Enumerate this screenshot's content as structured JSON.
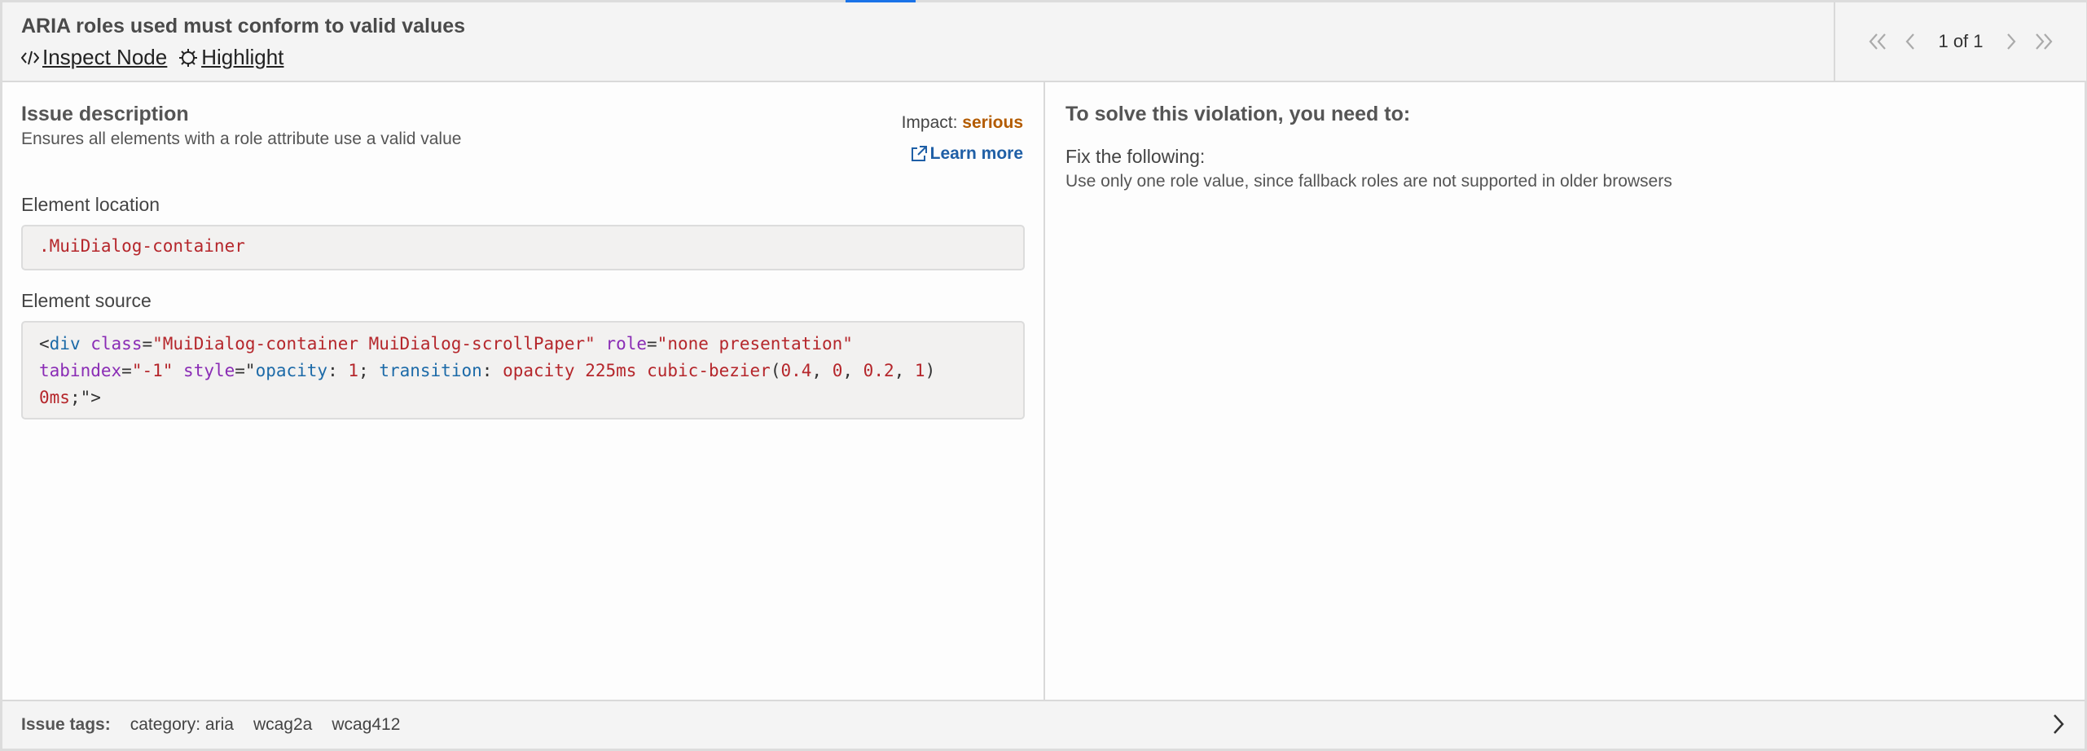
{
  "header": {
    "title": "ARIA roles used must conform to valid values",
    "inspect_label": " Inspect Node",
    "highlight_label": " Highlight"
  },
  "pager": {
    "count_text": "1 of 1"
  },
  "issue": {
    "heading": "Issue description",
    "description": "Ensures all elements with a role attribute use a valid value",
    "impact_label": "Impact:",
    "impact_value": "serious",
    "learn_more": "Learn more",
    "location_label": "Element location",
    "location_value": ".MuiDialog-container",
    "source_label": "Element source",
    "source_tokens": {
      "open": "<",
      "tag": "div",
      "a1": "class",
      "v1": "\"MuiDialog-container MuiDialog-scrollPaper\"",
      "a2": "role",
      "v2": "\"none presentation\"",
      "a3": "tabindex",
      "v3": "\"-1\"",
      "a4": "style",
      "p1": "opacity",
      "n1": "1",
      "p2": "transition",
      "v4a": "opacity",
      "v4b": "225ms",
      "v4c": "cubic-bezier",
      "v4d": "0.4",
      "v4e": "0",
      "v4f": "0.2",
      "v4g": "1",
      "v4h": "0ms"
    }
  },
  "solve": {
    "heading": "To solve this violation, you need to:",
    "fix_label": "Fix the following:",
    "fix_text": "Use only one role value, since fallback roles are not supported in older browsers"
  },
  "footer": {
    "tags_label": "Issue tags:",
    "tags": [
      "category: aria",
      "wcag2a",
      "wcag412"
    ]
  },
  "colors": {
    "accent": "#1a73e8",
    "impact": "#b35b00",
    "link": "#1f5fa6"
  }
}
